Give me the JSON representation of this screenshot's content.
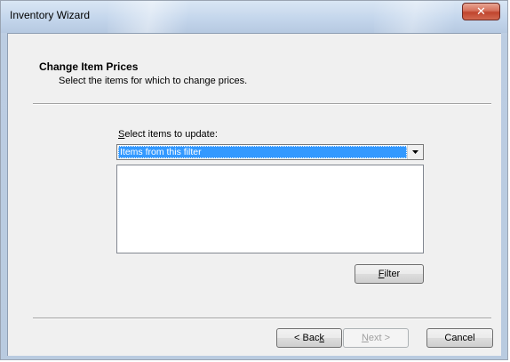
{
  "window": {
    "title": "Inventory Wizard",
    "close_glyph": "✕"
  },
  "header": {
    "heading": "Change Item Prices",
    "subheading": "Select the items for which to change prices."
  },
  "selection": {
    "label_mnemonic": "S",
    "label_rest": "elect items to update:",
    "selected_value": "Items from this filter",
    "list_items": []
  },
  "buttons": {
    "filter_mnemonic": "F",
    "filter_rest": "ilter",
    "back_prefix": "< Bac",
    "back_mnemonic": "k",
    "next_mnemonic": "N",
    "next_rest": "ext >",
    "cancel_label": "Cancel"
  },
  "colors": {
    "selection_highlight": "#3399ff",
    "close_button": "#c0452e",
    "dialog_background": "#f0f0f0"
  },
  "icons": {
    "close": "close-icon",
    "dropdown": "chevron-down-icon"
  }
}
